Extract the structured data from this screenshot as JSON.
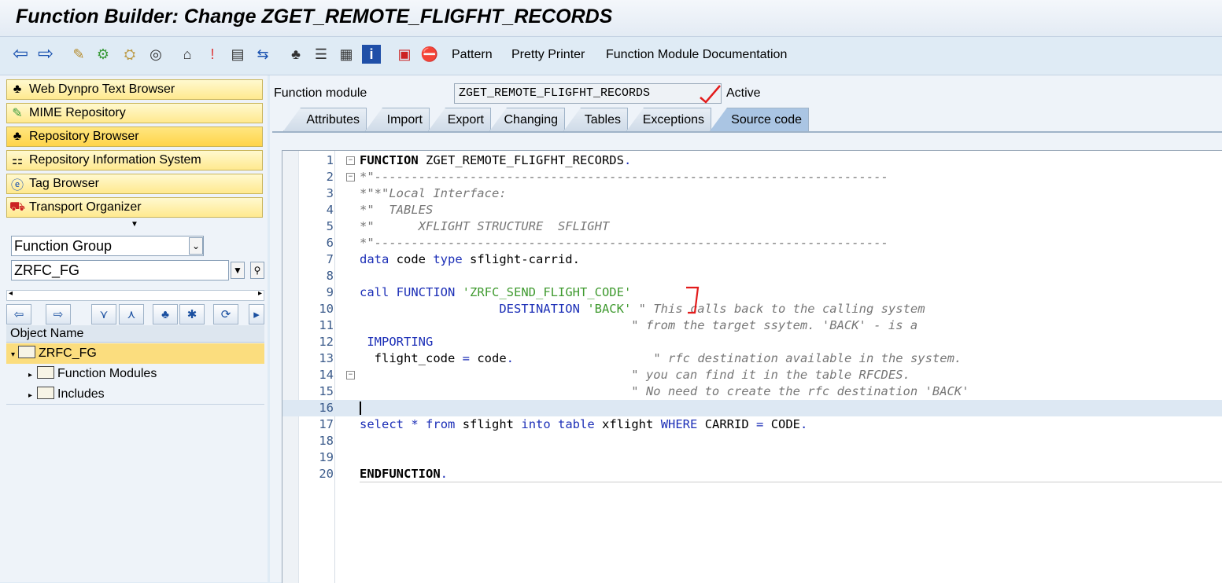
{
  "window": {
    "title": "Function Builder: Change ZGET_REMOTE_FLIGFHT_RECORDS"
  },
  "toolbar": {
    "icons": [
      "back-arrow-icon",
      "forward-arrow-icon",
      "other-object-icon",
      "check-icon",
      "activate-icon",
      "test-icon",
      "where-used-icon",
      "object-list-icon",
      "display-navigation-icon",
      "main-program-icon",
      "insert-row-icon",
      "enhance-icon",
      "hierarchy-icon",
      "stack-icon",
      "list-icon",
      "info-icon",
      "breakpoint-icon",
      "stop-icon"
    ],
    "pattern": "Pattern",
    "pretty_printer": "Pretty Printer",
    "documentation": "Function Module Documentation"
  },
  "nav": {
    "items": [
      {
        "label": "Web Dynpro Text Browser",
        "icon": "hierarchy-icon"
      },
      {
        "label": "MIME Repository",
        "icon": "mime-icon"
      },
      {
        "label": "Repository Browser",
        "icon": "hierarchy-icon"
      },
      {
        "label": "Repository Information System",
        "icon": "info-system-icon"
      },
      {
        "label": "Tag Browser",
        "icon": "tag-icon"
      },
      {
        "label": "Transport Organizer",
        "icon": "truck-icon"
      }
    ],
    "object_type": "Function Group",
    "object_name": "ZRFC_FG",
    "tree_header": "Object Name",
    "tree": {
      "root": "ZRFC_FG",
      "children": [
        "Function Modules",
        "Includes"
      ]
    }
  },
  "main": {
    "fm_label": "Function module",
    "fm_name": "ZGET_REMOTE_FLIGFHT_RECORDS",
    "status": "Active",
    "tabs": [
      "Attributes",
      "Import",
      "Export",
      "Changing",
      "Tables",
      "Exceptions",
      "Source code"
    ],
    "active_tab": "Source code"
  },
  "code_lines": [
    {
      "n": "1",
      "parts": [
        [
          "kwb",
          "FUNCTION"
        ],
        [
          "dark",
          " ZGET_REMOTE_FLIGFHT_RECORDS"
        ],
        [
          "kw",
          "."
        ]
      ]
    },
    {
      "n": "2",
      "parts": [
        [
          "cmt",
          "*\"----------------------------------------------------------------------"
        ]
      ]
    },
    {
      "n": "3",
      "parts": [
        [
          "cmt",
          "*\"*\"Local Interface:"
        ]
      ]
    },
    {
      "n": "4",
      "parts": [
        [
          "cmt",
          "*\"  TABLES"
        ]
      ]
    },
    {
      "n": "5",
      "parts": [
        [
          "cmt",
          "*\"      XFLIGHT STRUCTURE  SFLIGHT"
        ]
      ]
    },
    {
      "n": "6",
      "parts": [
        [
          "cmt",
          "*\"----------------------------------------------------------------------"
        ]
      ]
    },
    {
      "n": "7",
      "parts": [
        [
          "kw",
          "data"
        ],
        [
          "dark",
          " code "
        ],
        [
          "kw",
          "type"
        ],
        [
          "dark",
          " sflight-carrid."
        ]
      ]
    },
    {
      "n": "8",
      "parts": []
    },
    {
      "n": "9",
      "parts": [
        [
          "kw",
          "call FUNCTION"
        ],
        [
          "dark",
          " "
        ],
        [
          "str",
          "'ZRFC_SEND_FLIGHT_CODE'"
        ]
      ]
    },
    {
      "n": "10",
      "parts": [
        [
          "dark",
          "                   "
        ],
        [
          "kw",
          "DESTINATION"
        ],
        [
          "dark",
          " "
        ],
        [
          "str",
          "'BACK'"
        ],
        [
          "dark",
          " "
        ],
        [
          "cmt",
          "\" This calls back to the calling system"
        ]
      ]
    },
    {
      "n": "11",
      "parts": [
        [
          "cmt",
          "                                     \" from the target ssytem. 'BACK' - is a"
        ]
      ]
    },
    {
      "n": "12",
      "parts": [
        [
          "kw",
          " IMPORTING"
        ]
      ]
    },
    {
      "n": "13",
      "parts": [
        [
          "dark",
          "  flight_code "
        ],
        [
          "kw",
          "="
        ],
        [
          "dark",
          " code"
        ],
        [
          "kw",
          "."
        ],
        [
          "dark",
          "                   "
        ],
        [
          "cmt",
          "\" rfc destination available in the system."
        ]
      ]
    },
    {
      "n": "14",
      "parts": [
        [
          "cmt",
          "                                     \" you can find it in the table RFCDES."
        ]
      ]
    },
    {
      "n": "15",
      "parts": [
        [
          "cmt",
          "                                     \" No need to create the rfc destination 'BACK'"
        ]
      ]
    },
    {
      "n": "16",
      "parts": []
    },
    {
      "n": "17",
      "parts": [
        [
          "kw",
          "select"
        ],
        [
          "dark",
          " "
        ],
        [
          "kw",
          "*"
        ],
        [
          "dark",
          " "
        ],
        [
          "kw",
          "from"
        ],
        [
          "dark",
          " sflight "
        ],
        [
          "kw",
          "into table"
        ],
        [
          "dark",
          " xflight "
        ],
        [
          "kw",
          "WHERE"
        ],
        [
          "dark",
          " CARRID "
        ],
        [
          "kw",
          "="
        ],
        [
          "dark",
          " CODE"
        ],
        [
          "kw",
          "."
        ]
      ]
    },
    {
      "n": "18",
      "parts": []
    },
    {
      "n": "19",
      "parts": []
    },
    {
      "n": "20",
      "parts": [
        [
          "kwb",
          "ENDFUNCTION"
        ],
        [
          "kw",
          "."
        ]
      ]
    }
  ]
}
